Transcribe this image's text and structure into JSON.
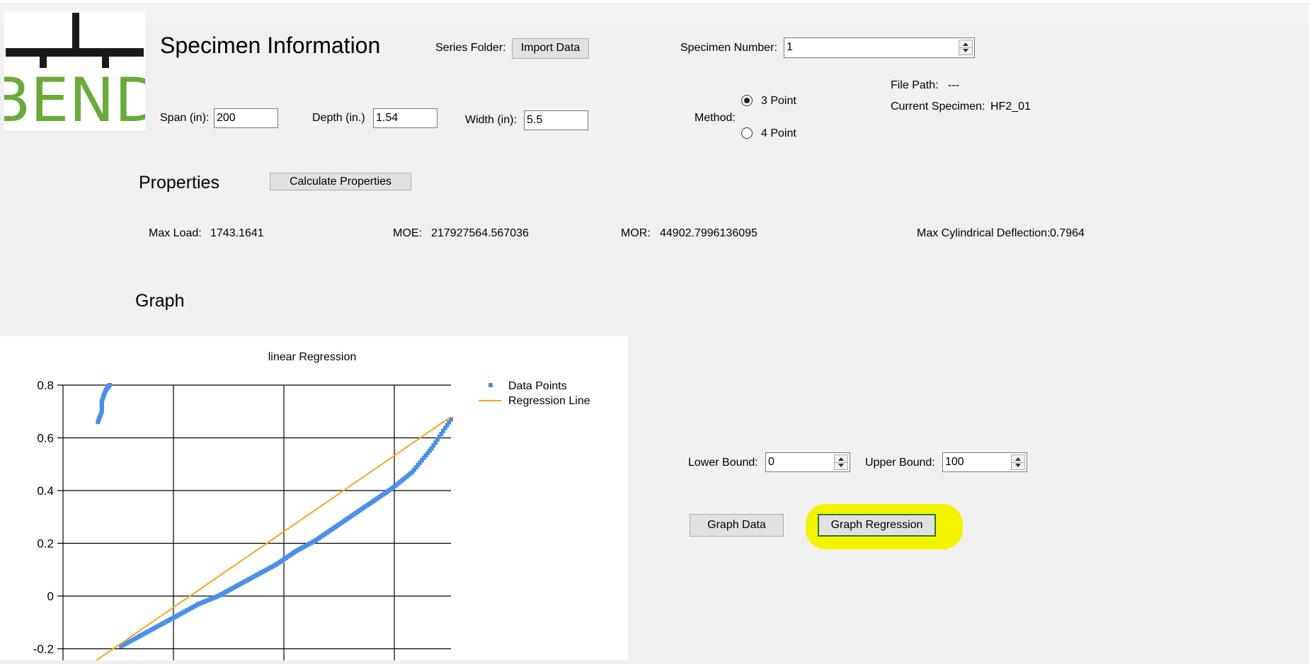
{
  "header": {
    "title": "Specimen Information",
    "series_folder_label": "Series Folder:",
    "import_button": "Import Data",
    "specimen_number_label": "Specimen Number:",
    "specimen_number_value": "1"
  },
  "logo": {
    "text": "BEND",
    "colors": {
      "bar": "#1a1a1a",
      "text": "#6aaa3a"
    }
  },
  "dimensions": {
    "span_label": "Span (in):",
    "span_value": "200",
    "depth_label": "Depth (in.)",
    "depth_value": "1.54",
    "width_label": "Width (in):",
    "width_value": "5.5"
  },
  "method": {
    "label": "Method:",
    "options": [
      {
        "label": "3 Point",
        "selected": true
      },
      {
        "label": "4 Point",
        "selected": false
      }
    ]
  },
  "file_info": {
    "file_path_label": "File Path:",
    "file_path_value": "---",
    "current_specimen_label": "Current Specimen:",
    "current_specimen_value": "HF2_01"
  },
  "properties": {
    "heading": "Properties",
    "calculate_button": "Calculate Properties",
    "max_load_label": "Max Load:",
    "max_load_value": "1743.1641",
    "moe_label": "MOE:",
    "moe_value": "217927564.567036",
    "mor_label": "MOR:",
    "mor_value": "44902.7996136095",
    "max_defl_label": "Max Cylindrical Deflection:",
    "max_defl_value": "0.7964"
  },
  "graph": {
    "heading": "Graph",
    "lower_bound_label": "Lower Bound:",
    "lower_bound_value": "0",
    "upper_bound_label": "Upper Bound:",
    "upper_bound_value": "100",
    "graph_data_button": "Graph Data",
    "graph_regression_button": "Graph Regression"
  },
  "colors": {
    "points": "#4a8fe8",
    "regression": "#f5a623",
    "highlight": "#f3f300",
    "focus_border": "#2a7a2a"
  },
  "chart_data": {
    "type": "scatter",
    "title": "linear Regression",
    "xlabel": "",
    "ylabel": "",
    "ylim": [
      -0.25,
      0.8
    ],
    "xlim": [
      0,
      1
    ],
    "yticks": [
      "0.8",
      "0.6",
      "0.4",
      "0.2",
      "0",
      "-0.2"
    ],
    "ytick_values": [
      0.8,
      0.6,
      0.4,
      0.2,
      0,
      -0.2
    ],
    "grid": true,
    "legend_position": "right",
    "series": [
      {
        "name": "Data Points",
        "kind": "scatter",
        "x": [
          0.09,
          0.1,
          0.1,
          0.11,
          0.12,
          0.15,
          0.2,
          0.25,
          0.3,
          0.35,
          0.4,
          0.45,
          0.5,
          0.55,
          0.6,
          0.65,
          0.7,
          0.75,
          0.8,
          0.85,
          0.9,
          0.95,
          1.0
        ],
        "y": [
          0.66,
          0.7,
          0.74,
          0.78,
          0.8,
          -0.19,
          -0.15,
          -0.11,
          -0.07,
          -0.03,
          0.0,
          0.04,
          0.08,
          0.12,
          0.17,
          0.21,
          0.26,
          0.31,
          0.36,
          0.41,
          0.47,
          0.56,
          0.67
        ]
      },
      {
        "name": "Regression Line",
        "kind": "line",
        "x": [
          0.08,
          1.0
        ],
        "y": [
          -0.25,
          0.68
        ]
      }
    ]
  }
}
